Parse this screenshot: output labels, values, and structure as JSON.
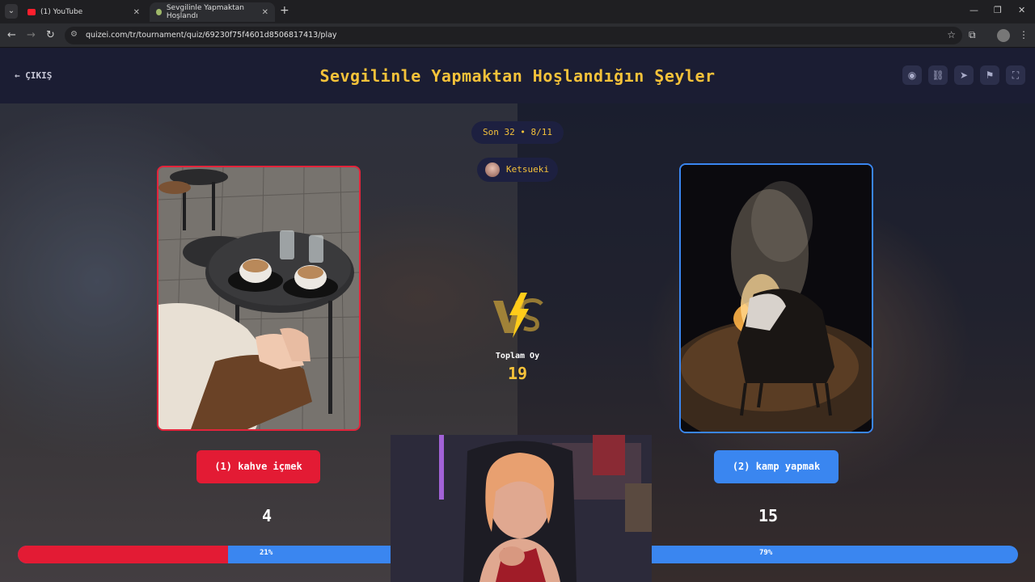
{
  "browser": {
    "tabs": [
      {
        "title": "(1) YouTube"
      },
      {
        "title": "Sevgilinle Yapmaktan Hoşlandı"
      }
    ],
    "url": "quizei.com/tr/tournament/quiz/69230f75f4601d8506817413/play"
  },
  "header": {
    "exit_label": "ÇIKIŞ",
    "title": "Sevgilinle Yapmaktan Hoşlandığın Şeyler"
  },
  "round": {
    "label": "Son 32 • 8/11",
    "creator": "Ketsueki"
  },
  "totals": {
    "label": "Toplam Oy",
    "value": "19"
  },
  "choices": [
    {
      "label": "(1) kahve içmek",
      "votes": "4",
      "percent_text": "21%",
      "percent": 21,
      "color": "#e31b34"
    },
    {
      "label": "(2) kamp yapmak",
      "votes": "15",
      "percent_text": "79%",
      "percent": 79,
      "color": "#3a86f0"
    }
  ],
  "colors": {
    "accent": "#f5c23a",
    "left": "#e31b34",
    "right": "#3a86f0"
  }
}
